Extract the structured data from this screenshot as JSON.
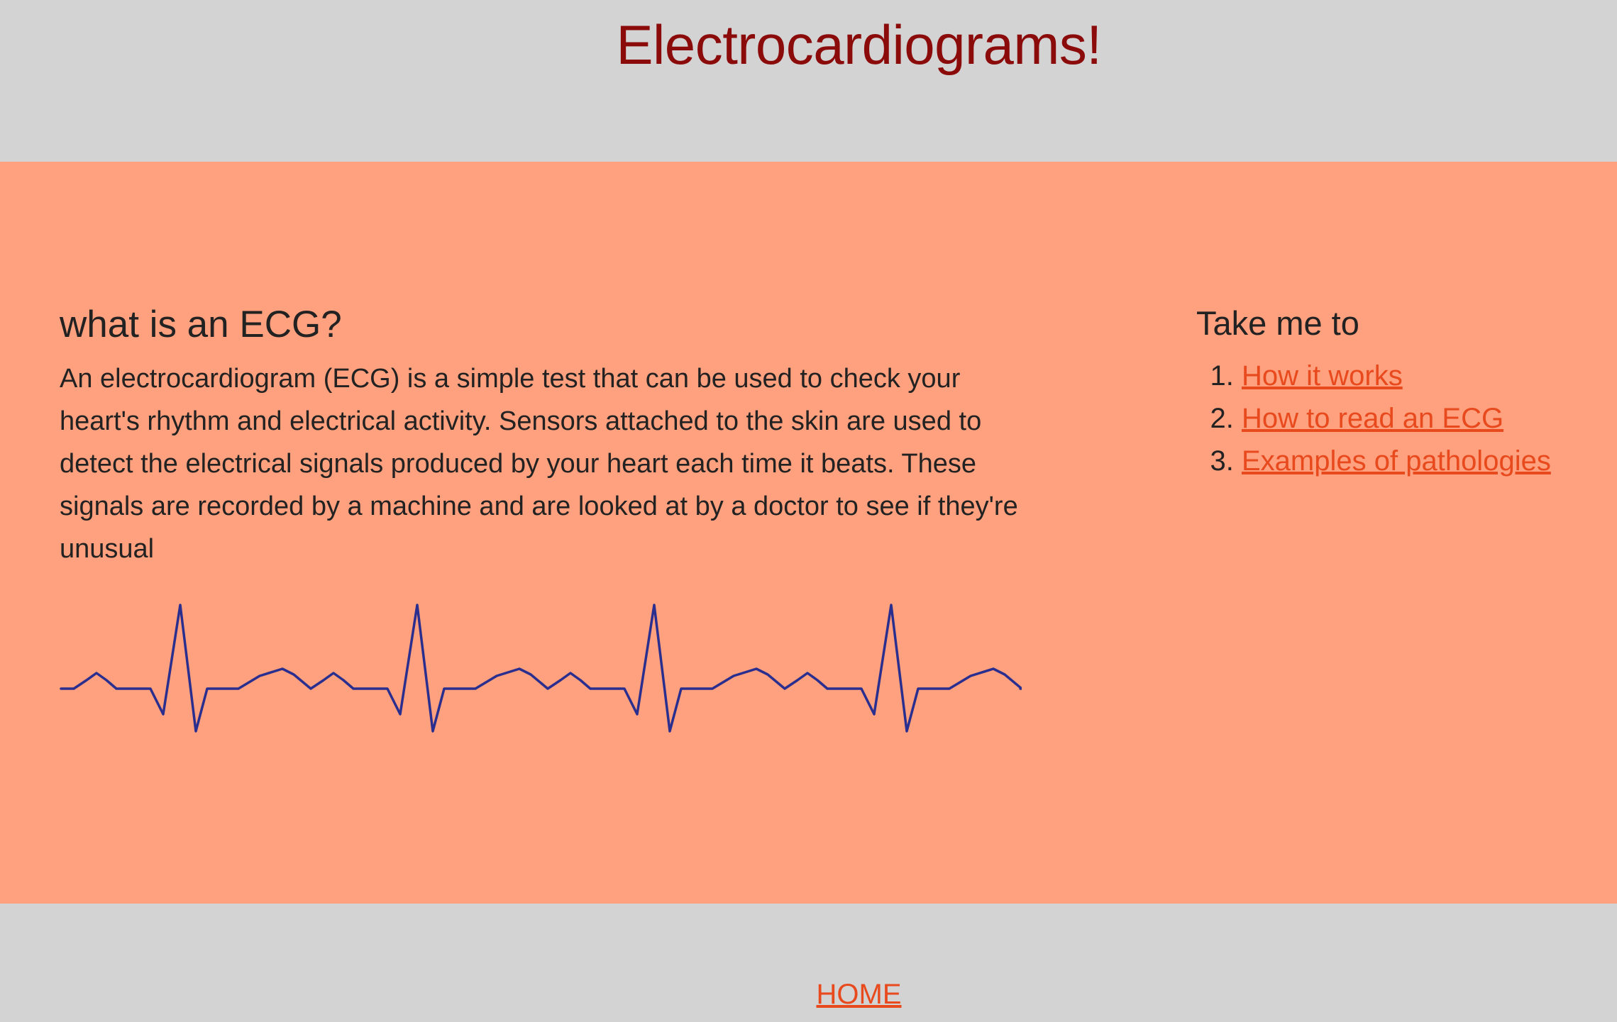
{
  "header": {
    "title": "Electrocardiograms!"
  },
  "main": {
    "heading": "what is an ECG?",
    "body": "An electrocardiogram (ECG) is a simple test that can be used to check your heart's rhythm and electrical activity. Sensors attached to the skin are used to detect the electrical signals produced by your heart each time it beats. These signals are recorded by a machine and are looked at by a doctor to see if they're unusual",
    "ecg_line_color": "#2a2f8f"
  },
  "sidebar": {
    "heading": "Take me to",
    "links": [
      {
        "label": "How it works"
      },
      {
        "label": "How to read an ECG"
      },
      {
        "label": "Examples of pathologies"
      }
    ]
  },
  "footer": {
    "home_label": "HOME"
  },
  "colors": {
    "header_bg": "#d3d3d3",
    "main_bg": "#ffa07e",
    "title": "#8b0a0a",
    "link": "#e8491d",
    "text": "#222222"
  }
}
